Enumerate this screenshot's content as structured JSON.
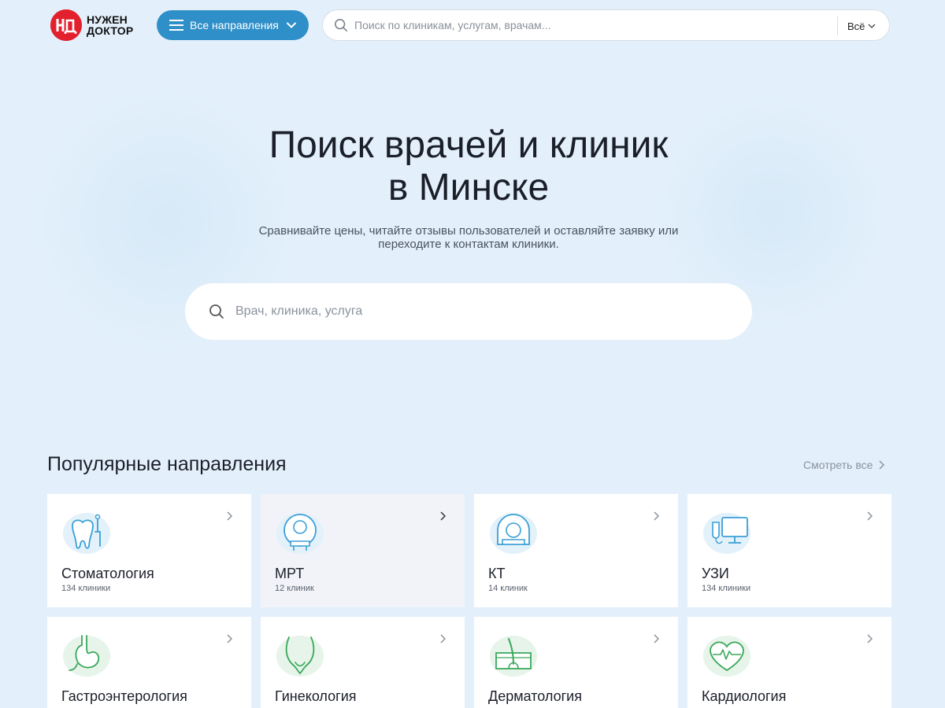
{
  "header": {
    "logo_text_line1": "НУЖЕН",
    "logo_text_line2": "ДОКТОР",
    "directions_label": "Все направления",
    "search_placeholder": "Поиск по клиникам, услугам, врачам...",
    "search_scope": "Всё"
  },
  "hero": {
    "title_line1": "Поиск врачей и клиник",
    "title_line2": "в Минске",
    "subtitle_line1": "Сравнивайте цены, читайте отзывы пользователей и оставляйте заявку или",
    "subtitle_line2": "переходите к контактам клиники.",
    "search_placeholder": "Врач, клиника, услуга"
  },
  "popular": {
    "title": "Популярные направления",
    "see_all": "Смотреть все",
    "cards": [
      {
        "name": "Стоматология",
        "count": "134 клиники",
        "icon": "tooth-icon"
      },
      {
        "name": "МРТ",
        "count": "12 клиник",
        "icon": "mri-scanner-icon"
      },
      {
        "name": "КТ",
        "count": "14 клиник",
        "icon": "ct-scanner-icon"
      },
      {
        "name": "УЗИ",
        "count": "134 клиники",
        "icon": "ultrasound-icon"
      },
      {
        "name": "Гастроэнтерология",
        "count": "",
        "icon": "stomach-icon"
      },
      {
        "name": "Гинекология",
        "count": "",
        "icon": "uterus-icon"
      },
      {
        "name": "Дерматология",
        "count": "",
        "icon": "skin-icon"
      },
      {
        "name": "Кардиология",
        "count": "",
        "icon": "heart-icon"
      }
    ]
  },
  "colors": {
    "background": "#e3f0fb",
    "accent": "#2f8fc8",
    "brand_red": "#e3202e",
    "icon_blue": "#3a9fd6",
    "icon_green": "#3aa85a"
  }
}
